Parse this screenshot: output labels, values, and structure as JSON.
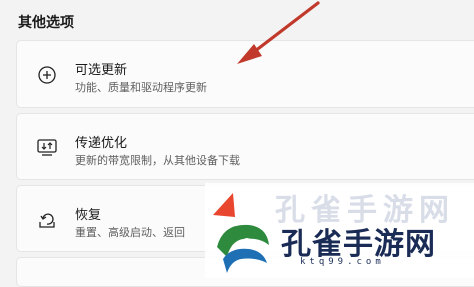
{
  "section": {
    "title": "其他选项"
  },
  "cards": [
    {
      "title": "可选更新",
      "desc": "功能、质量和驱动程序更新",
      "icon": "plus-circle-icon"
    },
    {
      "title": "传递优化",
      "desc": "更新的带宽限制，从其他设备下载",
      "icon": "delivery-optimization-icon"
    },
    {
      "title": "恢复",
      "desc": "重置、高级启动、返回",
      "icon": "recovery-icon"
    }
  ],
  "watermark": {
    "title": "孔雀手游网",
    "url": "ktq99.com"
  },
  "colors": {
    "arrow": "#c0392b",
    "card_bg": "#fbfbfb",
    "page_bg": "#f3f3f3"
  }
}
